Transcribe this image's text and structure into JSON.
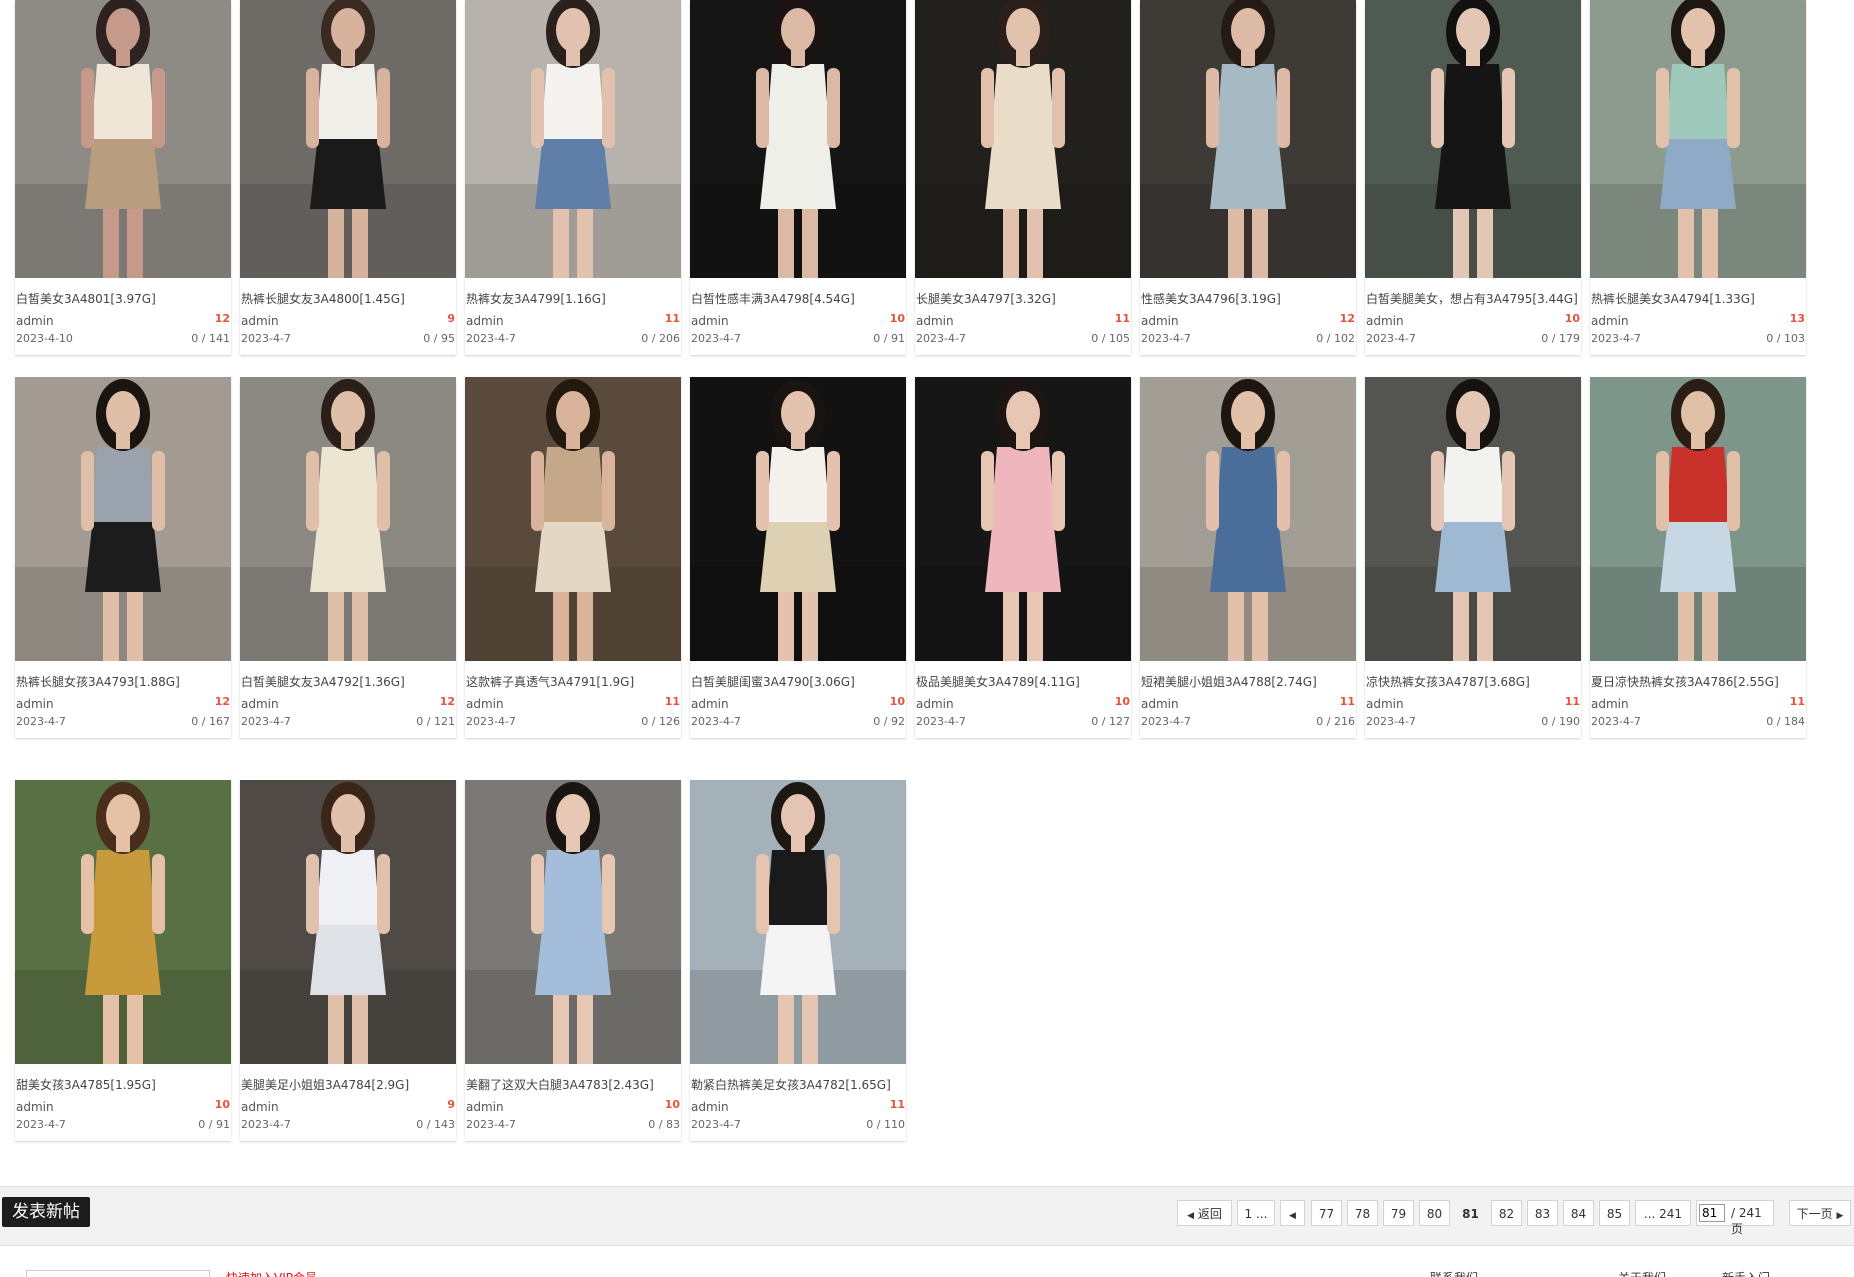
{
  "posts": [
    {
      "title": "白皙美女3A4801[3.97G]",
      "author": "admin",
      "count": "12",
      "date": "2023-4-10",
      "stats": "0 / 141",
      "palette": [
        "#8e8a86",
        "#b89d7f",
        "#efe6d8",
        "#c59a8a",
        "#2e2220"
      ]
    },
    {
      "title": "热裤长腿女友3A4800[1.45G]",
      "author": "admin",
      "count": "9",
      "date": "2023-4-7",
      "stats": "0 / 95",
      "palette": [
        "#6f6c68",
        "#1a1a1a",
        "#f1efe9",
        "#d7b39e",
        "#3a2b22"
      ]
    },
    {
      "title": "热裤女友3A4799[1.16G]",
      "author": "admin",
      "count": "11",
      "date": "2023-4-7",
      "stats": "0 / 206",
      "palette": [
        "#b7b3ac",
        "#5f7fa8",
        "#f4f3ef",
        "#e2c2ae",
        "#2b211c"
      ]
    },
    {
      "title": "白皙性感丰满3A4798[4.54G]",
      "author": "admin",
      "count": "10",
      "date": "2023-4-7",
      "stats": "0 / 91",
      "palette": [
        "#151515",
        "#efefea",
        "#efefea",
        "#dcb9a4",
        "#1c1412"
      ]
    },
    {
      "title": "长腿美女3A4797[3.32G]",
      "author": "admin",
      "count": "11",
      "date": "2023-4-7",
      "stats": "0 / 105",
      "palette": [
        "#22201d",
        "#e9ddca",
        "#e9ddca",
        "#e2c1ad",
        "#2a1f19"
      ]
    },
    {
      "title": "性感美女3A4796[3.19G]",
      "author": "admin",
      "count": "12",
      "date": "2023-4-7",
      "stats": "0 / 102",
      "palette": [
        "#3e3a36",
        "#a7bac4",
        "#a7bac4",
        "#dcbaa5",
        "#241a15"
      ]
    },
    {
      "title": "白皙美腿美女，想占有3A4795[3.44G]",
      "author": "admin",
      "count": "10",
      "date": "2023-4-7",
      "stats": "0 / 179",
      "palette": [
        "#4f5a52",
        "#151515",
        "#151515",
        "#e3c6b3",
        "#111111"
      ]
    },
    {
      "title": "热裤长腿美女3A4794[1.33G]",
      "author": "admin",
      "count": "13",
      "date": "2023-4-7",
      "stats": "0 / 103",
      "palette": [
        "#8d9a8e",
        "#8eaac6",
        "#9fc9bb",
        "#e3c2ab",
        "#1d1612"
      ]
    },
    {
      "title": "热裤长腿女孩3A4793[1.88G]",
      "author": "admin",
      "count": "12",
      "date": "2023-4-7",
      "stats": "0 / 167",
      "palette": [
        "#a39b92",
        "#1c1c1c",
        "#9aa3ad",
        "#e0bfa8",
        "#1b1512"
      ]
    },
    {
      "title": "白皙美腿女友3A4792[1.36G]",
      "author": "admin",
      "count": "12",
      "date": "2023-4-7",
      "stats": "0 / 121",
      "palette": [
        "#8c8882",
        "#ece5d2",
        "#ece5d2",
        "#dfbfa8",
        "#2a1f18"
      ]
    },
    {
      "title": "这款裤子真透气3A4791[1.9G]",
      "author": "admin",
      "count": "11",
      "date": "2023-4-7",
      "stats": "0 / 126",
      "palette": [
        "#5a4a3c",
        "#e4d7c3",
        "#c4a889",
        "#d9b39a",
        "#24190f"
      ]
    },
    {
      "title": "白皙美腿闺蜜3A4790[3.06G]",
      "author": "admin",
      "count": "10",
      "date": "2023-4-7",
      "stats": "0 / 92",
      "palette": [
        "#121212",
        "#ddd0b3",
        "#f4f1ec",
        "#e4c3ae",
        "#1a1411"
      ]
    },
    {
      "title": "极品美腿美女3A4789[4.11G]",
      "author": "admin",
      "count": "10",
      "date": "2023-4-7",
      "stats": "0 / 127",
      "palette": [
        "#161616",
        "#f0b6bd",
        "#f0b6bd",
        "#e7c6b4",
        "#1c1511"
      ]
    },
    {
      "title": "短裙美腿小姐姐3A4788[2.74G]",
      "author": "admin",
      "count": "11",
      "date": "2023-4-7",
      "stats": "0 / 216",
      "palette": [
        "#a39e95",
        "#4b6d9a",
        "#4b6d9a",
        "#e2c0aa",
        "#1c1510"
      ]
    },
    {
      "title": "凉快热裤女孩3A4787[3.68G]",
      "author": "admin",
      "count": "11",
      "date": "2023-4-7",
      "stats": "0 / 190",
      "palette": [
        "#545450",
        "#9fb9d2",
        "#f2f2f0",
        "#e4c6b4",
        "#151210"
      ]
    },
    {
      "title": "夏日凉快热裤女孩3A4786[2.55G]",
      "author": "admin",
      "count": "11",
      "date": "2023-4-7",
      "stats": "0 / 184",
      "palette": [
        "#7e958a",
        "#c7d7e3",
        "#c8322b",
        "#e1c0a8",
        "#2b1d14"
      ]
    },
    {
      "title": "甜美女孩3A4785[1.95G]",
      "author": "admin",
      "count": "10",
      "date": "2023-4-7",
      "stats": "0 / 91",
      "palette": [
        "#597044",
        "#c79a3b",
        "#c79a3b",
        "#e4c1a7",
        "#4a2e1c"
      ]
    },
    {
      "title": "美腿美足小姐姐3A4784[2.9G]",
      "author": "admin",
      "count": "9",
      "date": "2023-4-7",
      "stats": "0 / 143",
      "palette": [
        "#4f4a45",
        "#dee2e6",
        "#eef0f3",
        "#e1c1ac",
        "#3a2618"
      ]
    },
    {
      "title": "美翻了这双大白腿3A4783[2.43G]",
      "author": "admin",
      "count": "10",
      "date": "2023-4-7",
      "stats": "0 / 83",
      "palette": [
        "#7b7975",
        "#a4bddb",
        "#a4bddb",
        "#e5c7b4",
        "#1b1511"
      ]
    },
    {
      "title": "勒紧白热裤美足女孩3A4782[1.65G]",
      "author": "admin",
      "count": "11",
      "date": "2023-4-7",
      "stats": "0 / 110",
      "palette": [
        "#a4b1b8",
        "#f4f4f4",
        "#1a1a1a",
        "#e4c5b1",
        "#1e1813"
      ]
    }
  ],
  "toolbar": {
    "new_post_label": "发表新帖"
  },
  "pagination": {
    "back_label": "返回",
    "first_label": "1 ...",
    "pages": [
      "77",
      "78",
      "79",
      "80",
      "81",
      "82",
      "83",
      "84",
      "85"
    ],
    "current": "81",
    "last_label": "... 241",
    "input_value": "81",
    "total_label": "/ 241 页",
    "next_label": "下一页"
  },
  "footer": {
    "notice": "快速加入VIP会员",
    "link_contact": "联系我们",
    "link_about": "关于我们",
    "link_help": "新手入门"
  },
  "icons": {
    "prev": "triangle-left",
    "next": "triangle-right"
  }
}
